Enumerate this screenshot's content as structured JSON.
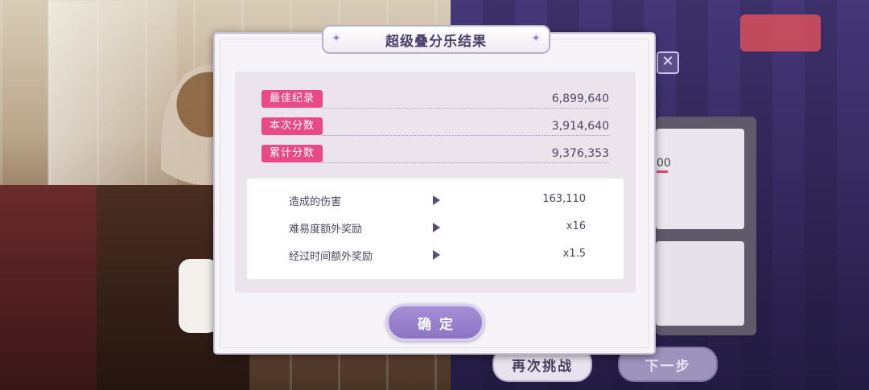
{
  "background": {
    "retry_button": "再次挑战",
    "next_button": "下一步",
    "side_value_fragment": "00",
    "close_glyph": "✕"
  },
  "dialog": {
    "title": "超级叠分乐结果",
    "sparkle_glyph": "✦",
    "scores": [
      {
        "label": "最佳纪录",
        "value": "6,899,640"
      },
      {
        "label": "本次分数",
        "value": "3,914,640"
      },
      {
        "label": "累计分数",
        "value": "9,376,353"
      }
    ],
    "bonuses": [
      {
        "label": "造成的伤害",
        "value": "163,110"
      },
      {
        "label": "难易度额外奖励",
        "value": "x16"
      },
      {
        "label": "经过时间额外奖励",
        "value": "x1.5"
      }
    ],
    "confirm_label": "确定"
  },
  "colors": {
    "score_label_bg": "#e94a86",
    "confirm_button": "#9a82cc",
    "title_text": "#4b3f69"
  }
}
